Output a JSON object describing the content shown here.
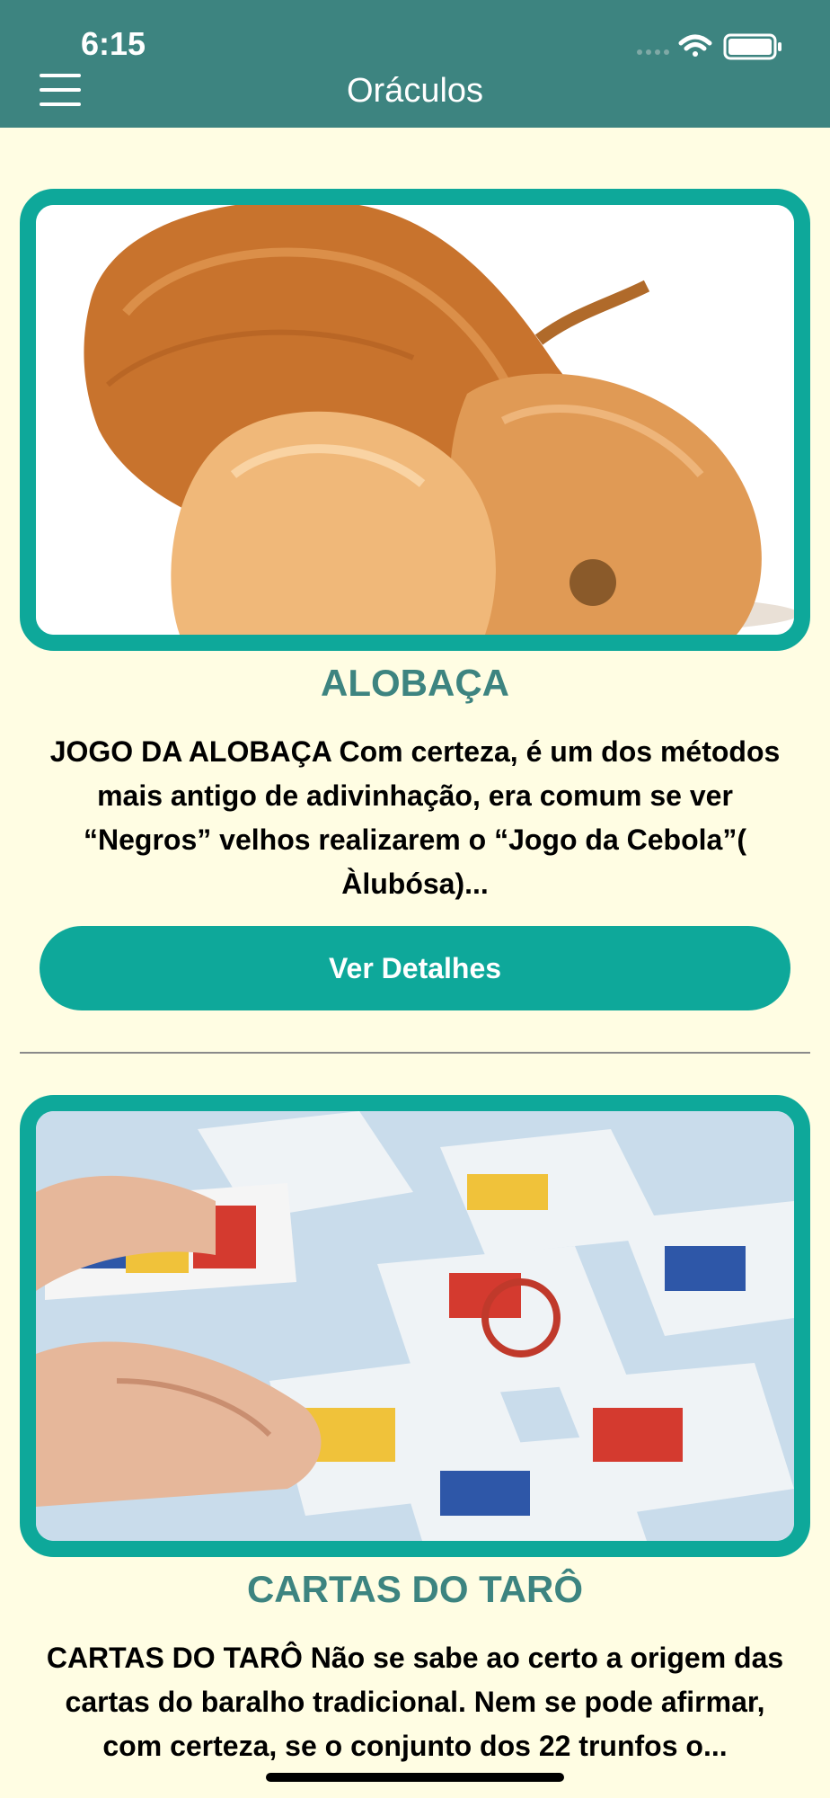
{
  "status_bar": {
    "time": "6:15"
  },
  "header": {
    "title": "Oráculos",
    "menu_icon": "hamburger-menu-icon"
  },
  "colors": {
    "header_bg": "#3D8480",
    "accent": "#0EA89A",
    "page_bg": "#FFFDE3",
    "title_text": "#3D8480"
  },
  "cards": [
    {
      "image": "onions-photo",
      "title": "ALOBAÇA",
      "description": "JOGO DA ALOBAÇA   Com certeza, é um dos métodos mais antigo de adivinhação, era comum se ver “Negros” velhos realizarem o “Jogo da Cebola”( Àlubósa)...",
      "button_label": "Ver Detalhes"
    },
    {
      "image": "tarot-cards-photo",
      "title": "CARTAS DO TARÔ",
      "description": "CARTAS  DO  TARÔ   Não se sabe ao certo a origem das cartas do baralho tradicional. Nem se pode afirmar, com certeza, se o conjunto dos 22 trunfos o..."
    }
  ]
}
